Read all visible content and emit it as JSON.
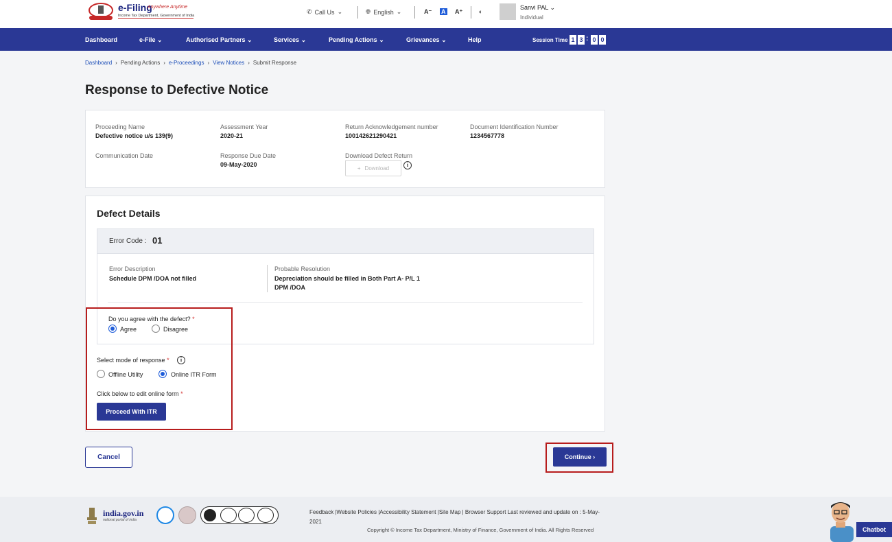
{
  "header": {
    "logo_title": "e-Filing",
    "logo_tagline": "Anywhere Anytime",
    "logo_subtitle": "Income Tax Department, Government of India",
    "call_us": "Call Us",
    "language": "English",
    "font_decrease": "A⁻",
    "font_normal": "A",
    "font_increase": "A⁺",
    "user_name": "Sanvi PAL",
    "user_role": "Individual"
  },
  "nav": {
    "items": [
      "Dashboard",
      "e-File",
      "Authorised Partners",
      "Services",
      "Pending Actions",
      "Grievances",
      "Help"
    ],
    "session_label": "Session Time",
    "session_digits": [
      "1",
      "3",
      "0",
      "0"
    ]
  },
  "breadcrumb": [
    "Dashboard",
    "Pending Actions",
    "e-Proceedings",
    "View Notices",
    "Submit Response"
  ],
  "page_title": "Response to Defective Notice",
  "proceeding": {
    "proceeding_name_label": "Proceeding Name",
    "proceeding_name": "Defective notice u/s 139(9)",
    "assessment_year_label": "Assessment Year",
    "assessment_year": "2020-21",
    "ack_number_label": "Return Acknowledgement number",
    "ack_number": "100142621290421",
    "din_label": "Document Identification Number",
    "din": "1234567778",
    "communication_date_label": "Communication Date",
    "response_due_label": "Response Due Date",
    "response_due": "09-May-2020",
    "download_label": "Download Defect Return",
    "download_button": "Download"
  },
  "defect": {
    "section_title": "Defect Details",
    "error_code_label": "Error Code :",
    "error_code": "01",
    "description_label": "Error Description",
    "description": "Schedule DPM /DOA not filled",
    "resolution_label": "Probable Resolution",
    "resolution_line1": "Depreciation should be filled in Both Part A- P/L 1",
    "resolution_line2": "DPM /DOA",
    "agree_question": "Do you agree with the defect?",
    "agree_label": "Agree",
    "disagree_label": "Disagree",
    "agree_selected": true
  },
  "response_mode": {
    "label": "Select mode of response",
    "offline_label": "Offline Utility",
    "online_label": "Online ITR Form",
    "selected": "online",
    "edit_label": "Click below to edit online form",
    "proceed_button": "Proceed With ITR"
  },
  "actions": {
    "cancel": "Cancel",
    "continue": "Continue"
  },
  "footer": {
    "india_gov": "india.gov.in",
    "india_gov_sub": "national portal of india",
    "links_line1": "Feedback |Website Policies |Accessibility Statement |Site Map | Browser Support   Last reviewed and update on : 5-May-",
    "links_line2": "2021",
    "copyright": "Copyright © Income Tax Department, Ministry of Finance, Government of India. All Rights Reserved",
    "chatbot": "Chatbot"
  },
  "colors": {
    "primary": "#2a3895",
    "accent_blue": "#1e5cd9",
    "highlight_red": "#b71c1c",
    "required": "#d32f2f"
  }
}
